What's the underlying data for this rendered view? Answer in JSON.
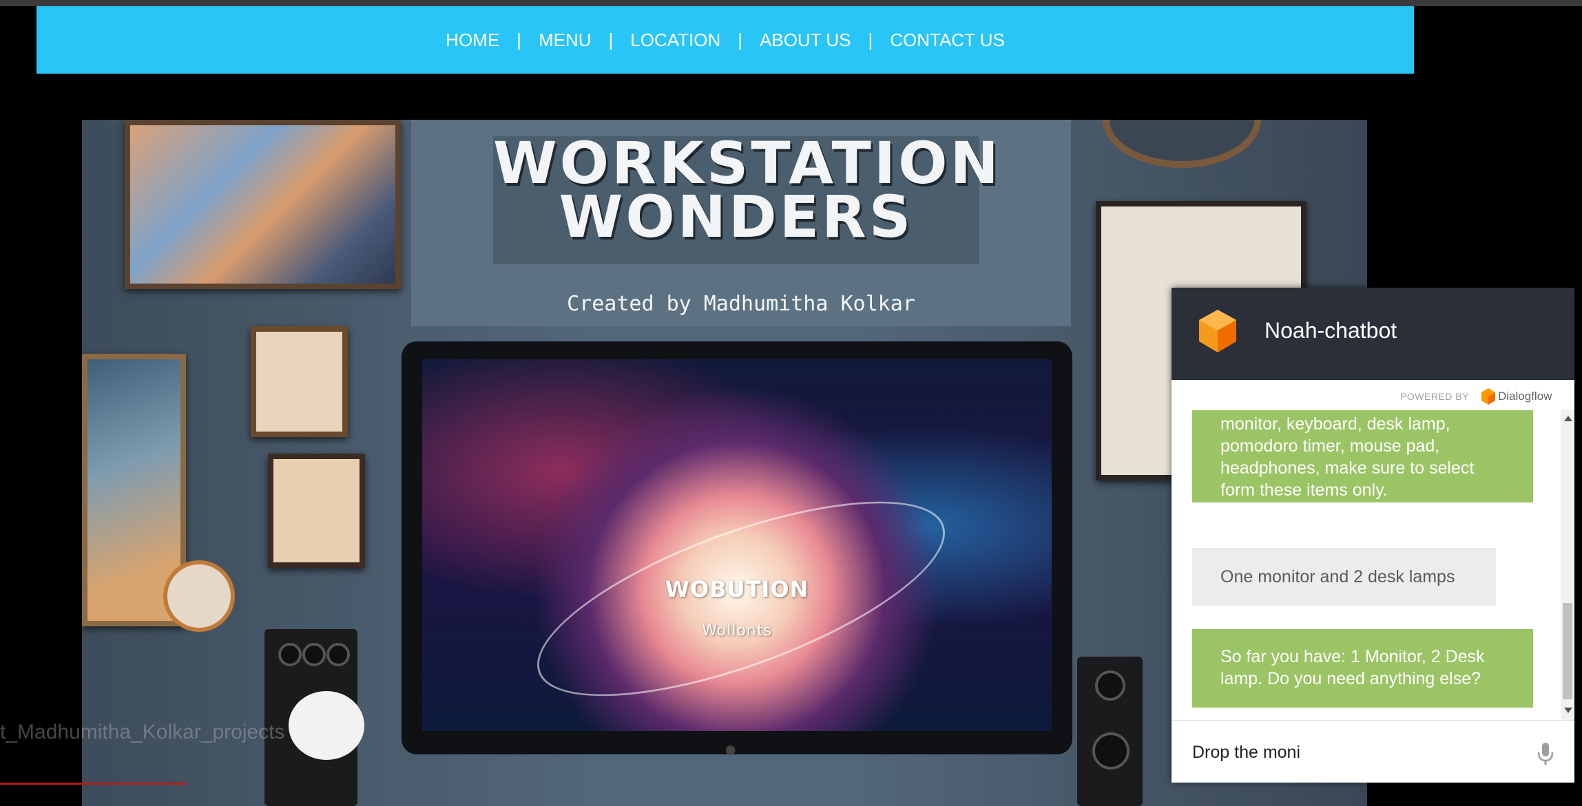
{
  "nav": {
    "items": [
      "HOME",
      "MENU",
      "LOCATION",
      "ABOUT US",
      "CONTACT US"
    ],
    "separator": "|"
  },
  "hero": {
    "title": "WORKSTATION\nWONDERS",
    "credit": "Created by Madhumitha Kolkar",
    "screen_title": "WOBUTION",
    "screen_subtitle": "Wollonts"
  },
  "watermark": "t_Madhumitha_Kolkar_projects",
  "chatbot": {
    "title": "Noah-chatbot",
    "powered_by": "POWERED BY",
    "provider": "Dialogflow",
    "messages": [
      {
        "from": "bot",
        "text": "monitor, keyboard, desk lamp, pomodoro timer, mouse pad, headphones, make sure to select form these items only."
      },
      {
        "from": "user",
        "text": "One monitor and 2 desk lamps"
      },
      {
        "from": "bot",
        "text": "So far you have: 1 Monitor, 2 Desk lamp. Do you need anything else?"
      }
    ],
    "input_value": "Drop the moni"
  },
  "colors": {
    "nav_bg": "#29c5f6",
    "chat_header_bg": "#2b2f3a",
    "bot_bubble": "#9bc465",
    "user_bubble": "#ececec",
    "dialogflow_orange": "#ff9800"
  },
  "icons": {
    "chat_logo": "dialogflow-cube-icon",
    "mic": "microphone-icon",
    "apple": "apple-logo-icon"
  }
}
